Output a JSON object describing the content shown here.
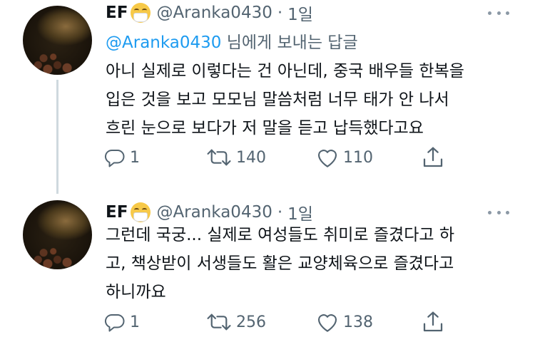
{
  "tweets": [
    {
      "name": "EF",
      "handle": "@Aranka0430",
      "separator": "·",
      "time": "1일",
      "reply_to_mention": "@Aranka0430",
      "reply_to_suffix": " 님에게 보내는 답글",
      "lines": [
        "아니 실제로 이렇다는 건 아닌데, 중국 배우들 한복을",
        "입은 것을 보고 모모님 말씀처럼 너무 태가 안 나서",
        "흐린 눈으로 보다가 저 말을 듣고 납득했다고요"
      ],
      "counts": {
        "replies": "1",
        "retweets": "140",
        "likes": "110"
      }
    },
    {
      "name": "EF",
      "handle": "@Aranka0430",
      "separator": "·",
      "time": "1일",
      "lines": [
        "그런데 국궁... 실제로 여성들도 취미로 즐겼다고 하",
        "고, 책상받이 서생들도 활은 교양체육으로 즐겼다고",
        "하니까요"
      ],
      "counts": {
        "replies": "1",
        "retweets": "256",
        "likes": "138"
      }
    }
  ],
  "icons": {
    "avatar": "profile-photo",
    "emoji": "face-with-medical-mask-emoji",
    "reply": "reply-icon",
    "retweet": "retweet-icon",
    "like": "heart-icon",
    "share": "share-icon",
    "more": "more-dots-icon"
  },
  "colors": {
    "text": "#0f1419",
    "secondary": "#536471",
    "link": "#1d9bf0",
    "thread_line": "#cfd9de"
  }
}
